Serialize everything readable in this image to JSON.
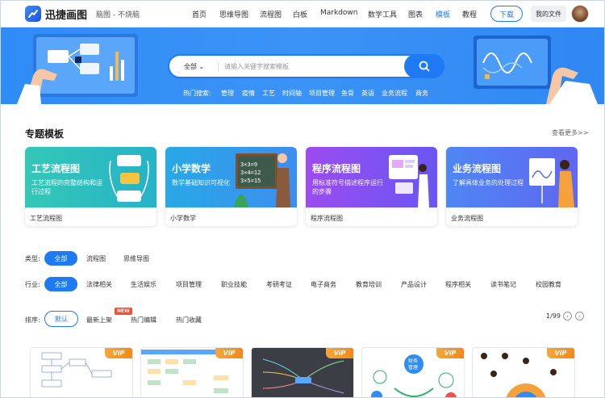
{
  "brand": {
    "name": "迅捷画图",
    "slogan": "脑图 - 不烧脑"
  },
  "nav": {
    "items": [
      {
        "label": "首页"
      },
      {
        "label": "思维导图"
      },
      {
        "label": "流程图"
      },
      {
        "label": "白板"
      },
      {
        "label": "Markdown"
      },
      {
        "label": "数学工具"
      },
      {
        "label": "图表"
      },
      {
        "label": "模板",
        "active": true
      },
      {
        "label": "教程"
      }
    ],
    "download": "下载",
    "my_files": "我的文件"
  },
  "search": {
    "scope": "全部",
    "placeholder": "请输入关键字搜索模板",
    "hot_label": "热门搜索:",
    "hot_terms": [
      "管理",
      "疫情",
      "工艺",
      "时间轴",
      "项目管理",
      "鱼骨",
      "英语",
      "业务流程",
      "商务"
    ]
  },
  "featured": {
    "title": "专题模板",
    "more": "查看更多>>",
    "cards": [
      {
        "title": "工艺流程图",
        "desc": "工艺流程的完整结构和运行过程",
        "name": "工艺流程图",
        "color1": "#35c9b8",
        "color2": "#27b0c7"
      },
      {
        "title": "小学数学",
        "desc": "数学基础知识可视化",
        "name": "小学数学",
        "color1": "#2aa7e6",
        "color2": "#3d8ef0"
      },
      {
        "title": "程序流程图",
        "desc": "用标准符号描述程序运行的步骤",
        "name": "程序流程图",
        "color1": "#9a4cf0",
        "color2": "#6b56f2"
      },
      {
        "title": "业务流程图",
        "desc": "了解具体业务的处理过程",
        "name": "业务流程图",
        "color1": "#4f86f5",
        "color2": "#5f67f0"
      }
    ]
  },
  "filters": {
    "type_label": "类型:",
    "types": [
      "全部",
      "流程图",
      "思维导图"
    ],
    "industry_label": "行业:",
    "industries": [
      "全部",
      "法律相关",
      "生活娱乐",
      "项目管理",
      "职业技能",
      "考研考证",
      "电子商务",
      "教育培训",
      "产品设计",
      "程序相关",
      "读书笔记",
      "校园教育"
    ],
    "sort_label": "排序:",
    "sorts": [
      "默认",
      "最新上架",
      "热门编辑",
      "热门收藏"
    ],
    "new_badge": "NEW",
    "page": "1/99"
  },
  "thumbs": {
    "vip": "ViP",
    "items": [
      {
        "kind": "flow",
        "bg": "#ffffff"
      },
      {
        "kind": "flow2",
        "bg": "#ffffff"
      },
      {
        "kind": "dark",
        "bg": "#3b3f45"
      },
      {
        "kind": "circle",
        "bg": "#ffffff",
        "center": "财务\n管理"
      },
      {
        "kind": "people",
        "bg": "#ffffff"
      }
    ]
  }
}
